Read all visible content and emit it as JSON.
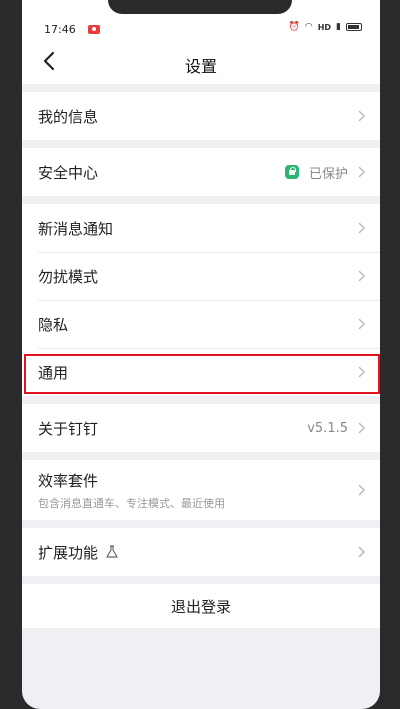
{
  "status": {
    "time": "17:46",
    "network": "HD"
  },
  "nav": {
    "title": "设置"
  },
  "groups": [
    {
      "items": [
        {
          "label": "我的信息"
        }
      ]
    },
    {
      "items": [
        {
          "label": "安全中心",
          "value": "已保护"
        }
      ]
    },
    {
      "items": [
        {
          "label": "新消息通知"
        },
        {
          "label": "勿扰模式"
        },
        {
          "label": "隐私"
        },
        {
          "label": "通用"
        }
      ]
    },
    {
      "items": [
        {
          "label": "关于钉钉",
          "value": "v5.1.5"
        }
      ]
    },
    {
      "items": [
        {
          "label": "效率套件",
          "sub": "包含消息直通车、专注模式、最近使用"
        }
      ]
    },
    {
      "items": [
        {
          "label": "扩展功能"
        }
      ]
    }
  ],
  "logout_label": "退出登录",
  "colors": {
    "highlight": "#e0121e",
    "protected_badge": "#2bb673"
  },
  "icons": {
    "back": "back-arrow-icon",
    "chevron": "chevron-right-icon",
    "shield": "shield-lock-icon",
    "flask": "flask-icon"
  }
}
